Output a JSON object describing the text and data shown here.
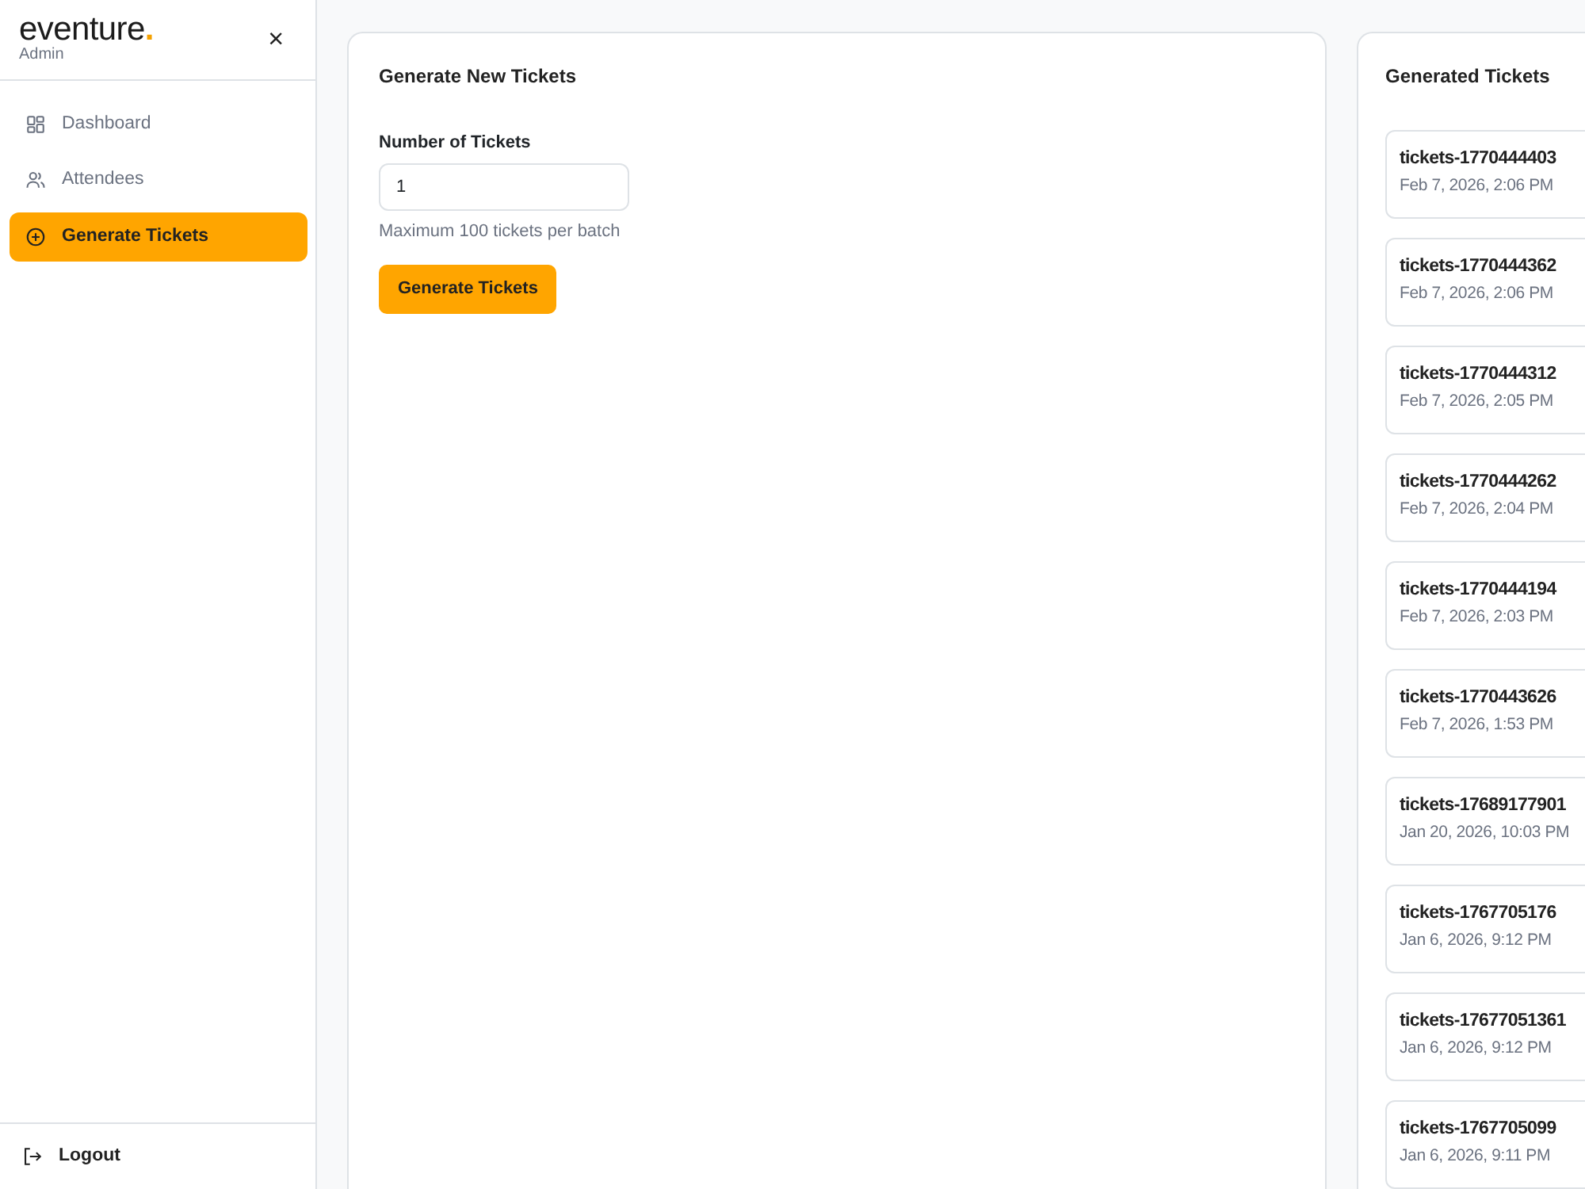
{
  "sidebar": {
    "logo": {
      "name": "eventure",
      "dot": "."
    },
    "subtitle": "Admin",
    "close": "×",
    "items": [
      {
        "label": "Dashboard",
        "kind": "grid",
        "selected": false
      },
      {
        "label": "Attendees",
        "kind": "people",
        "selected": false
      },
      {
        "label": "Generate Tickets",
        "kind": "plus",
        "selected": true
      }
    ],
    "logout": {
      "label": "Logout"
    }
  },
  "generate_form": {
    "title": "Generate New Tickets",
    "field_label": "Number of Tickets",
    "value": "1",
    "hint": "Maximum 100 tickets per batch",
    "button": "Generate Tickets"
  },
  "generated": {
    "title": "Generated Tickets",
    "items": [
      {
        "name": "tickets-1770444403",
        "date": "Feb 7, 2026, 2:06 PM"
      },
      {
        "name": "tickets-1770444362",
        "date": "Feb 7, 2026, 2:06 PM"
      },
      {
        "name": "tickets-1770444312",
        "date": "Feb 7, 2026, 2:05 PM"
      },
      {
        "name": "tickets-1770444262",
        "date": "Feb 7, 2026, 2:04 PM"
      },
      {
        "name": "tickets-1770444194",
        "date": "Feb 7, 2026, 2:03 PM"
      },
      {
        "name": "tickets-1770443626",
        "date": "Feb 7, 2026, 1:53 PM"
      },
      {
        "name": "tickets-17689177901",
        "date": "Jan 20, 2026, 10:03 PM"
      },
      {
        "name": "tickets-1767705176",
        "date": "Jan 6, 2026, 9:12 PM"
      },
      {
        "name": "tickets-17677051361",
        "date": "Jan 6, 2026, 9:12 PM"
      },
      {
        "name": "tickets-1767705099",
        "date": "Jan 6, 2026, 9:11 PM"
      }
    ]
  }
}
